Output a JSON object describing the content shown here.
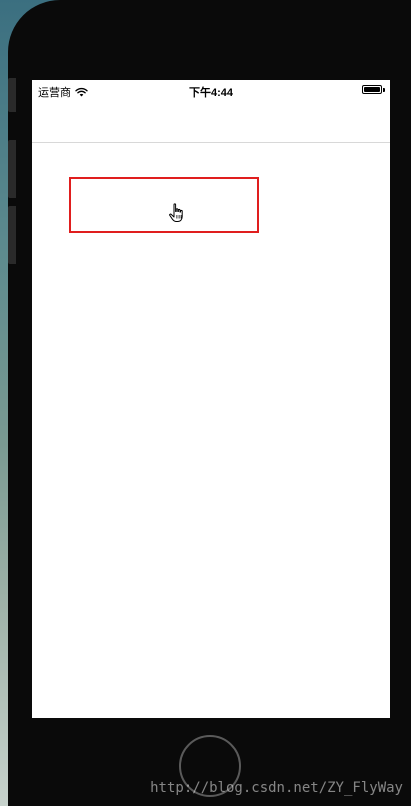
{
  "status_bar": {
    "carrier": "运营商",
    "time": "下午4:44"
  },
  "nav_bar": {
    "title": ""
  },
  "watermark": "http://blog.csdn.net/ZY_FlyWay",
  "colors": {
    "highlight_border": "#e01e1e",
    "phone_body": "#0a0a0a",
    "screen_bg": "#ffffff"
  },
  "icons": {
    "signal": "wifi-icon",
    "battery": "battery-icon",
    "pointer": "hand-cursor-icon"
  }
}
